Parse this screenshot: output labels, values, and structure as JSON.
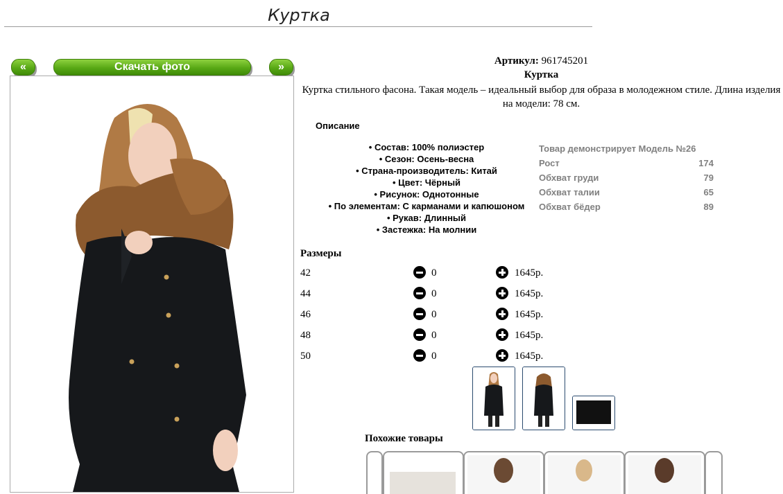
{
  "page": {
    "title": "Куртка"
  },
  "gallery": {
    "prev_label": "«",
    "download_label": "Скачать фото",
    "next_label": "»"
  },
  "product": {
    "article_label": "Артикул:",
    "article_value": "961745201",
    "name": "Куртка",
    "description": "Куртка стильного фасона. Такая модель – идеальный выбор для образа в молодежном стиле. Длина изделия на модели: 78 см."
  },
  "description_section": {
    "label": "Описание",
    "features": [
      "• Состав: 100% полиэстер",
      "• Сезон: Осень-весна",
      "• Страна-производитель: Китай",
      "• Цвет: Чёрный",
      "• Рисунок: Однотонные",
      "• По элементам: С карманами и капюшоном",
      "• Рукав: Длинный",
      "• Застежка: На молнии"
    ],
    "model": {
      "header": "Товар демонстрирует Модель №26",
      "rows": [
        {
          "label": "Рост",
          "value": "174"
        },
        {
          "label": "Обхват груди",
          "value": "79"
        },
        {
          "label": "Обхват талии",
          "value": "65"
        },
        {
          "label": "Обхват бёдер",
          "value": "89"
        }
      ]
    }
  },
  "sizes": {
    "label": "Размеры",
    "rows": [
      {
        "size": "42",
        "qty": "0",
        "price": "1645р."
      },
      {
        "size": "44",
        "qty": "0",
        "price": "1645р."
      },
      {
        "size": "46",
        "qty": "0",
        "price": "1645р."
      },
      {
        "size": "48",
        "qty": "0",
        "price": "1645р."
      },
      {
        "size": "50",
        "qty": "0",
        "price": "1645р."
      }
    ]
  },
  "similar": {
    "label": "Похожие товары"
  },
  "colors": {
    "button_green": "#58a815",
    "thumb_border": "#2a4a6e",
    "model_gray": "#808080"
  }
}
